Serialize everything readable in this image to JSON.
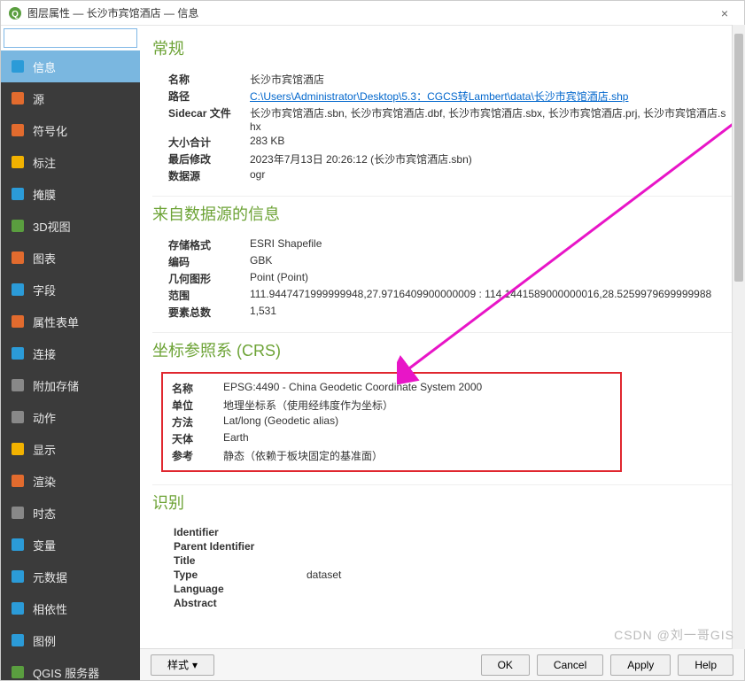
{
  "window": {
    "title": "图层属性 — 长沙市宾馆酒店 — 信息",
    "close": "×"
  },
  "search": {
    "placeholder": ""
  },
  "sidebar": {
    "items": [
      {
        "label": "信息",
        "active": true,
        "icon": "info"
      },
      {
        "label": "源",
        "active": false,
        "icon": "source"
      },
      {
        "label": "符号化",
        "active": false,
        "icon": "symbol"
      },
      {
        "label": "标注",
        "active": false,
        "icon": "label"
      },
      {
        "label": "掩膜",
        "active": false,
        "icon": "mask"
      },
      {
        "label": "3D视图",
        "active": false,
        "icon": "3d"
      },
      {
        "label": "图表",
        "active": false,
        "icon": "chart"
      },
      {
        "label": "字段",
        "active": false,
        "icon": "fields"
      },
      {
        "label": "属性表单",
        "active": false,
        "icon": "form"
      },
      {
        "label": "连接",
        "active": false,
        "icon": "join"
      },
      {
        "label": "附加存储",
        "active": false,
        "icon": "storage"
      },
      {
        "label": "动作",
        "active": false,
        "icon": "action"
      },
      {
        "label": "显示",
        "active": false,
        "icon": "display"
      },
      {
        "label": "渲染",
        "active": false,
        "icon": "render"
      },
      {
        "label": "时态",
        "active": false,
        "icon": "temporal"
      },
      {
        "label": "变量",
        "active": false,
        "icon": "variable"
      },
      {
        "label": "元数据",
        "active": false,
        "icon": "metadata"
      },
      {
        "label": "相依性",
        "active": false,
        "icon": "dependency"
      },
      {
        "label": "图例",
        "active": false,
        "icon": "legend"
      },
      {
        "label": "QGIS 服务器",
        "active": false,
        "icon": "server"
      }
    ]
  },
  "sections": {
    "general": {
      "title": "常规",
      "name_label": "名称",
      "name_value": "长沙市宾馆酒店",
      "path_label": "路径",
      "path_value": "C:\\Users\\Administrator\\Desktop\\5.3：CGCS转Lambert\\data\\长沙市宾馆酒店.shp",
      "sidecar_label": "Sidecar 文件",
      "sidecar_value": "长沙市宾馆酒店.sbn, 长沙市宾馆酒店.dbf, 长沙市宾馆酒店.sbx, 长沙市宾馆酒店.prj, 长沙市宾馆酒店.shx",
      "size_label": "大小合计",
      "size_value": "283 KB",
      "modified_label": "最后修改",
      "modified_value": "2023年7月13日 20:26:12 (长沙市宾馆酒店.sbn)",
      "provider_label": "数据源",
      "provider_value": "ogr"
    },
    "provider": {
      "title": "来自数据源的信息",
      "storage_label": "存储格式",
      "storage_value": "ESRI Shapefile",
      "encoding_label": "编码",
      "encoding_value": "GBK",
      "geom_label": "几何图形",
      "geom_value": "Point (Point)",
      "extent_label": "范围",
      "extent_value": "111.9447471999999948,27.9716409900000009 : 114.1441589000000016,28.5259979699999988",
      "count_label": "要素总数",
      "count_value": "1,531"
    },
    "crs": {
      "title": "坐标参照系 (CRS)",
      "name_label": "名称",
      "name_value": "EPSG:4490 - China Geodetic Coordinate System 2000",
      "unit_label": "单位",
      "unit_value": "地理坐标系（使用经纬度作为坐标）",
      "method_label": "方法",
      "method_value": "Lat/long (Geodetic alias)",
      "body_label": "天体",
      "body_value": "Earth",
      "ref_label": "参考",
      "ref_value": "静态（依赖于板块固定的基准面）"
    },
    "ident": {
      "title": "识别",
      "identifier_label": "Identifier",
      "identifier_value": "",
      "parent_label": "Parent Identifier",
      "parent_value": "",
      "title_label": "Title",
      "title_value": "",
      "type_label": "Type",
      "type_value": "dataset",
      "lang_label": "Language",
      "lang_value": "",
      "abstract_label": "Abstract",
      "abstract_value": ""
    }
  },
  "footer": {
    "style": "样式",
    "ok": "OK",
    "cancel": "Cancel",
    "apply": "Apply",
    "help": "Help"
  },
  "watermark": "CSDN @刘一哥GIS"
}
